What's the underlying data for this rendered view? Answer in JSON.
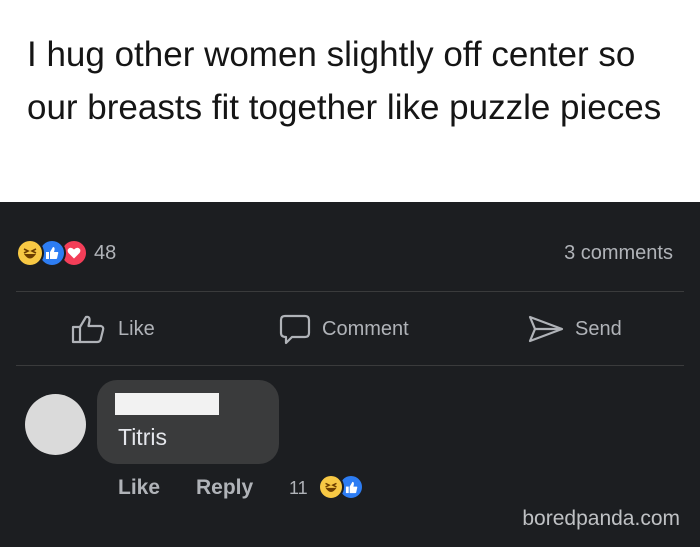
{
  "post": {
    "text": "I hug other women slightly off center so our breasts fit together like puzzle pieces"
  },
  "reactions": {
    "icons": [
      "haha-icon",
      "like-icon",
      "love-icon"
    ],
    "count": "48",
    "comments": "3 comments"
  },
  "actions": {
    "like": "Like",
    "comment": "Comment",
    "send": "Send"
  },
  "comment": {
    "text": "Titris",
    "like_label": "Like",
    "reply_label": "Reply",
    "reaction_count": "11",
    "reaction_icons": [
      "haha-icon",
      "like-icon"
    ]
  },
  "watermark": "boredpanda.com",
  "colors": {
    "panel_bg": "#1c1e21",
    "bubble_bg": "#3a3b3c",
    "muted_text": "#b0b3b8",
    "like_blue": "#2d7df3",
    "love_red": "#f33e58",
    "haha_yellow": "#f7c844"
  }
}
